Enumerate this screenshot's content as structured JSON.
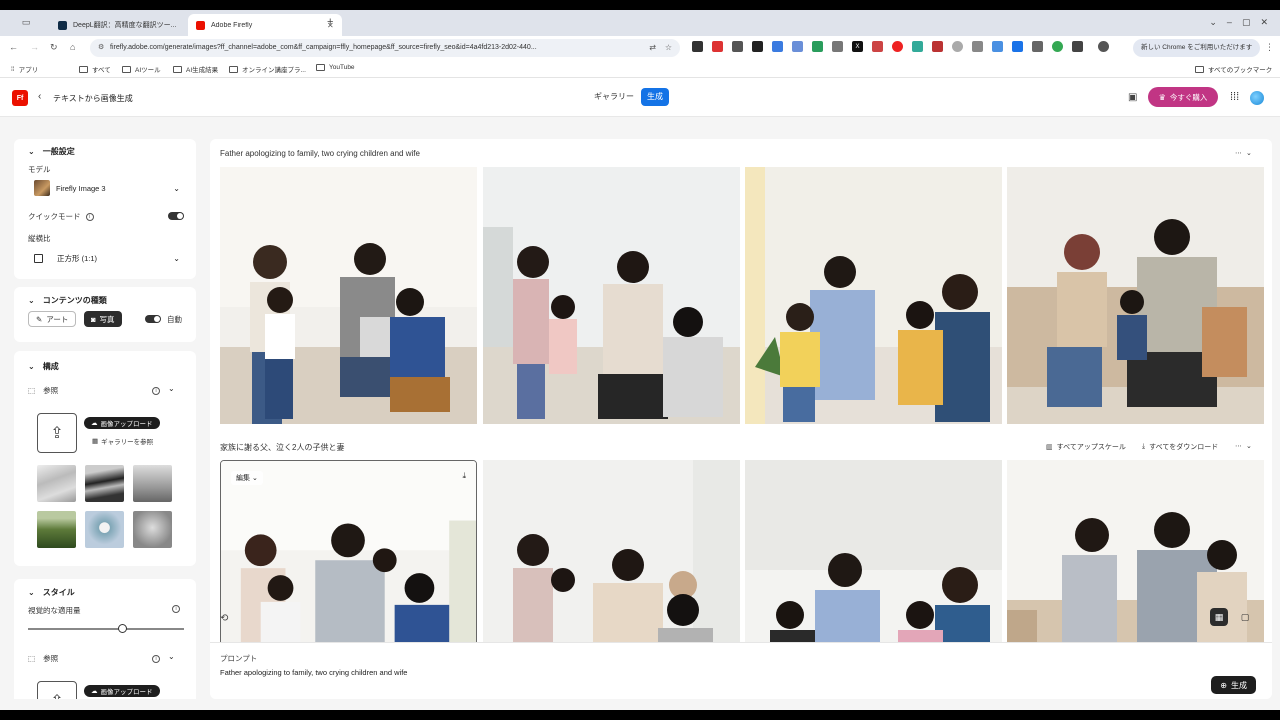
{
  "browser": {
    "tabs": [
      {
        "title": "DeepL翻訳：高精度な翻訳ツー...",
        "active": false
      },
      {
        "title": "Adobe Firefly",
        "active": true
      }
    ],
    "url": "firefly.adobe.com/generate/images?ff_channel=adobe_com&ff_campaign=ffly_homepage&ff_source=firefly_seo&id=4a4fd213-2d02-440...",
    "chrome_notice": "新しい Chrome をご利用いただけます",
    "bookmarks": [
      "アプリ",
      "すべて",
      "AIツール",
      "AI生成結果",
      "オンライン講座プラ...",
      "YouTube"
    ],
    "all_bookmarks": "すべてのブックマーク"
  },
  "app": {
    "logo": "Ff",
    "title": "テキストから画像生成",
    "gallery_label": "ギャラリー",
    "generate_label": "生成",
    "buy_label": "今すぐ購入"
  },
  "panel": {
    "general": {
      "heading": "一般設定",
      "model_label": "モデル",
      "model_value": "Firefly Image 3",
      "quick_mode_label": "クイックモード",
      "aspect_label": "縦横比",
      "aspect_value": "正方形 (1:1)"
    },
    "content_type": {
      "heading": "コンテンツの種類",
      "art_label": "アート",
      "photo_label": "写真",
      "auto_label": "自動"
    },
    "composition": {
      "heading": "構成",
      "ref_label": "参照",
      "upload_label": "画像アップロード",
      "browse_label": "ギャラリーを参照"
    },
    "style": {
      "heading": "スタイル",
      "intensity_label": "視覚的な適用量",
      "intensity_value": 0.6,
      "ref_label": "参照",
      "upload_label": "画像アップロード"
    }
  },
  "main": {
    "row1_prompt": "Father apologizing to family, two crying children and wife",
    "row2_prompt": "家族に謝る父、泣く2人の子供と妻",
    "upscale_all": "すべてアップスケール",
    "download_all": "すべてをダウンロード",
    "edit_label": "編集",
    "prompt_label": "プロンプト",
    "prompt_text": "Father apologizing to family, two crying children and wife",
    "generate_label": "生成"
  }
}
